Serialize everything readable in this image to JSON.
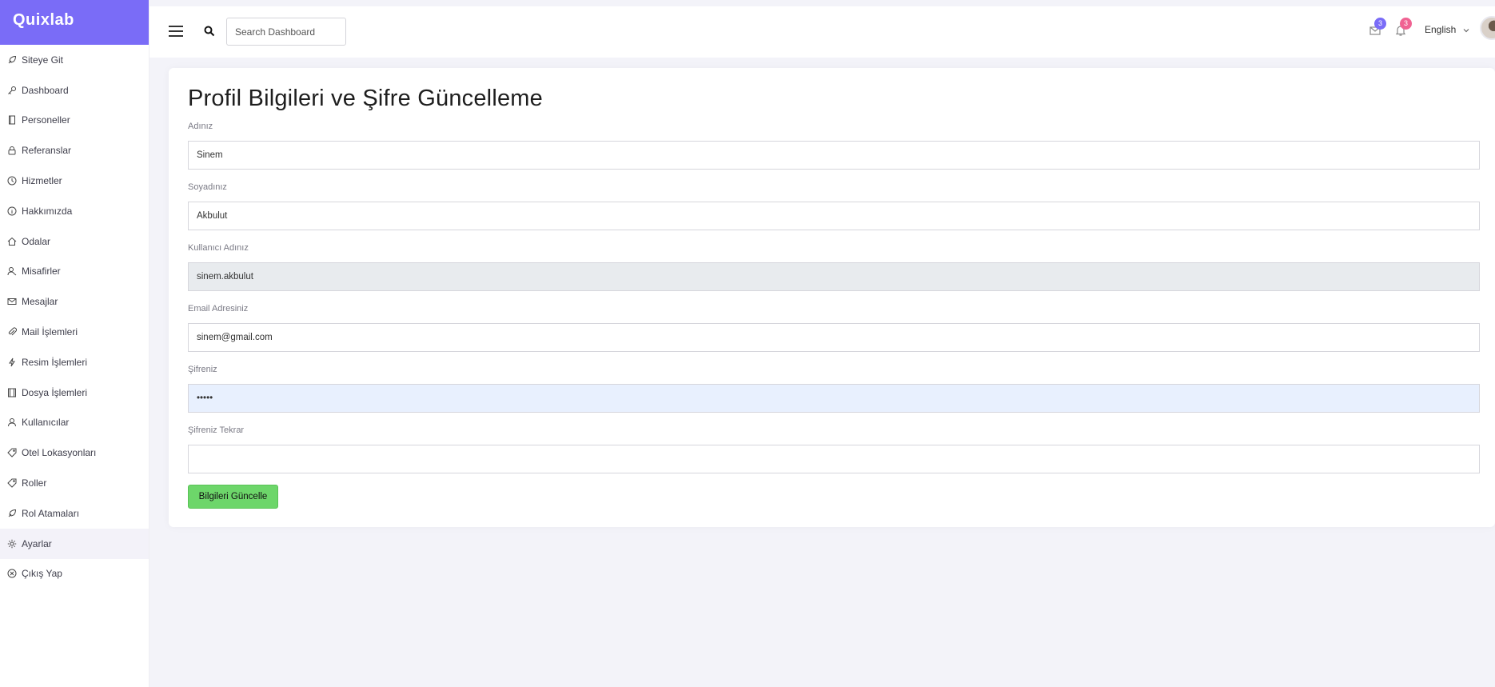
{
  "app": {
    "brand": "Quixlab"
  },
  "sidebar": {
    "items": [
      {
        "label": "Siteye Git",
        "icon": "rocket-icon"
      },
      {
        "label": "Dashboard",
        "icon": "key-icon"
      },
      {
        "label": "Personeller",
        "icon": "book-icon"
      },
      {
        "label": "Referanslar",
        "icon": "lock-icon"
      },
      {
        "label": "Hizmetler",
        "icon": "clock-icon"
      },
      {
        "label": "Hakkımızda",
        "icon": "info-icon"
      },
      {
        "label": "Odalar",
        "icon": "home-icon"
      },
      {
        "label": "Misafirler",
        "icon": "user-search-icon"
      },
      {
        "label": "Mesajlar",
        "icon": "envelope-icon"
      },
      {
        "label": "Mail İşlemleri",
        "icon": "paperclip-icon"
      },
      {
        "label": "Resim İşlemleri",
        "icon": "bolt-icon"
      },
      {
        "label": "Dosya İşlemleri",
        "icon": "film-icon"
      },
      {
        "label": "Kullanıcılar",
        "icon": "user-icon"
      },
      {
        "label": "Otel Lokasyonları",
        "icon": "tag-icon"
      },
      {
        "label": "Roller",
        "icon": "tag-icon"
      },
      {
        "label": "Rol Atamaları",
        "icon": "rocket-icon"
      },
      {
        "label": "Ayarlar",
        "icon": "gear-icon"
      },
      {
        "label": "Çıkış Yap",
        "icon": "close-circle-icon"
      }
    ],
    "active_index": 16
  },
  "header": {
    "search_placeholder": "Search Dashboard",
    "messages_count": "3",
    "notifications_count": "3",
    "language": "English"
  },
  "colors": {
    "brand": "#7a6cf7",
    "messages_badge": "#7a6cf7",
    "notifications_badge": "#f06292",
    "submit": "#6dd66a"
  },
  "form": {
    "title": "Profil Bilgileri ve Şifre Güncelleme",
    "first_name": {
      "label": "Adınız",
      "value": "Sinem"
    },
    "last_name": {
      "label": "Soyadınız",
      "value": "Akbulut"
    },
    "username": {
      "label": "Kullanıcı Adınız",
      "value": "sinem.akbulut"
    },
    "email": {
      "label": "Email Adresiniz",
      "value": "sinem@gmail.com"
    },
    "password": {
      "label": "Şifreniz",
      "value": "•••••"
    },
    "password_confirm": {
      "label": "Şifreniz Tekrar",
      "value": ""
    },
    "submit_label": "Bilgileri Güncelle"
  }
}
